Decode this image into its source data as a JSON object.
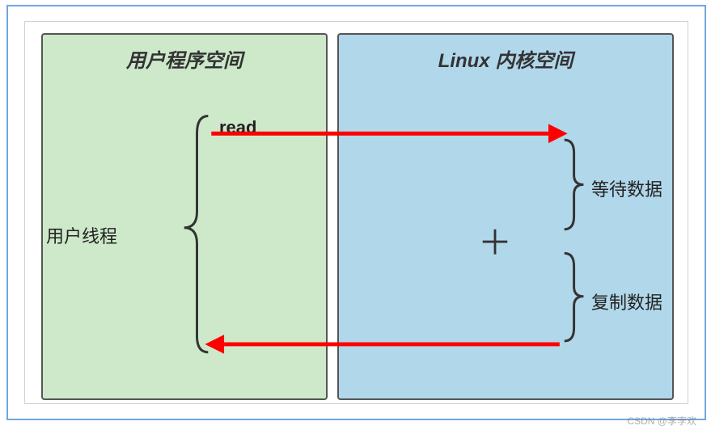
{
  "diagram": {
    "user_space_title": "用户程序空间",
    "kernel_space_title": "Linux 内核空间",
    "user_thread_label": "用户线程",
    "read_label": "read",
    "wait_label": "等待数据",
    "copy_label": "复制数据",
    "plus_symbol": "＋",
    "arrow1": {
      "from": "user.read",
      "to": "kernel.top",
      "color": "#ff0000"
    },
    "arrow2": {
      "from": "kernel.bottom",
      "to": "user.bottom",
      "color": "#ff0000"
    },
    "brace_big_color": "#333333",
    "brace_small_color": "#333333",
    "box_user_color": "#cde9ca",
    "box_kernel_color": "#b1d7ea"
  },
  "watermark": "CSDN @李孛欢"
}
